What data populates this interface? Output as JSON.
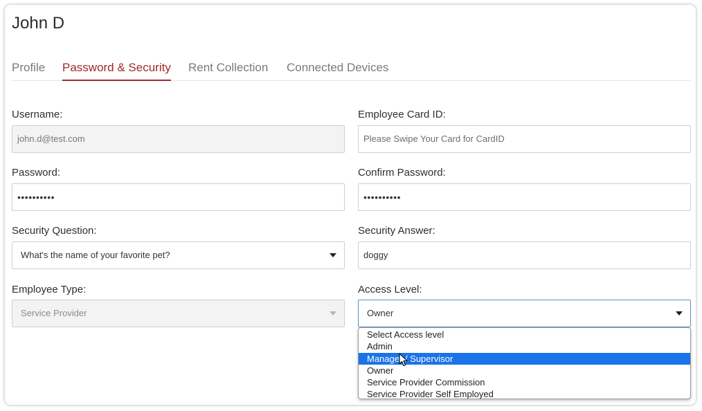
{
  "header": {
    "title": "John D"
  },
  "tabs": [
    {
      "label": "Profile",
      "active": false
    },
    {
      "label": "Password & Security",
      "active": true
    },
    {
      "label": "Rent Collection",
      "active": false
    },
    {
      "label": "Connected Devices",
      "active": false
    }
  ],
  "form": {
    "username": {
      "label": "Username:",
      "value": "john.d@test.com"
    },
    "employee_card_id": {
      "label": "Employee Card ID:",
      "placeholder": "Please Swipe Your Card for CardID"
    },
    "password": {
      "label": "Password:",
      "value": "••••••••••"
    },
    "confirm_password": {
      "label": "Confirm Password:",
      "value": "••••••••••"
    },
    "security_question": {
      "label": "Security Question:",
      "value": "What's the name of your favorite pet?"
    },
    "security_answer": {
      "label": "Security Answer:",
      "value": "doggy"
    },
    "employee_type": {
      "label": "Employee Type:",
      "value": "Service Provider"
    },
    "access_level": {
      "label": "Access Level:",
      "value": "Owner",
      "options": [
        "Select Access level",
        "Admin",
        "Manager / Supervisor",
        "Owner",
        "Service Provider Commission",
        "Service Provider Self Employed"
      ],
      "highlighted": "Manager / Supervisor"
    }
  },
  "colors": {
    "accent": "#a3272d",
    "highlight": "#1a73e8",
    "focus_border": "#5a91c8"
  },
  "icons": [
    "chevron-down-icon",
    "mouse-pointer-icon"
  ]
}
